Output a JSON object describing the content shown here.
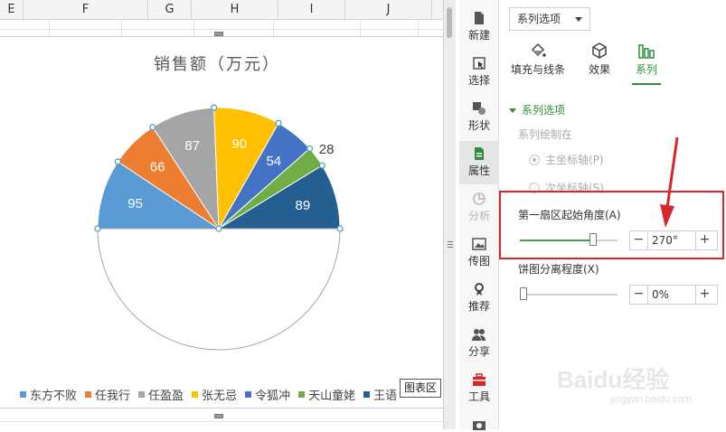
{
  "sheet": {
    "columns": [
      "E",
      "F",
      "G",
      "H",
      "I",
      "J"
    ]
  },
  "chart": {
    "tooltip": "图表区"
  },
  "chart_data": {
    "type": "pie",
    "title": "销售额（万元）",
    "first_slice_angle_deg": 270,
    "categories": [
      "东方不败",
      "任我行",
      "任盈盈",
      "张无忌",
      "令狐冲",
      "天山童姥",
      "王语嫣"
    ],
    "legend_labels": [
      "东方不败",
      "任我行",
      "任盈盈",
      "张无忌",
      "令狐冲",
      "天山童姥",
      "王语"
    ],
    "values": [
      95,
      66,
      87,
      90,
      54,
      28,
      89
    ],
    "colors": [
      "#5b9bd5",
      "#ed7d31",
      "#a5a5a5",
      "#ffc000",
      "#4472c4",
      "#70ad47",
      "#255e91"
    ],
    "hidden_slice": {
      "value": 509,
      "fill": "none",
      "border": "#a6a6a6"
    },
    "label_colors": [
      "#ffffff",
      "#ffffff",
      "#ffffff",
      "#ffffff",
      "#ffffff",
      "#404040",
      "#ffffff"
    ],
    "legend_position": "bottom"
  },
  "rail": {
    "items": [
      {
        "label": "新建",
        "icon": "new-doc-icon"
      },
      {
        "label": "选择",
        "icon": "select-cursor-icon"
      },
      {
        "label": "形状",
        "icon": "shapes-icon"
      },
      {
        "label": "属性",
        "icon": "properties-icon"
      },
      {
        "label": "分析",
        "icon": "analysis-icon"
      },
      {
        "label": "传图",
        "icon": "upload-image-icon"
      },
      {
        "label": "推荐",
        "icon": "recommend-icon"
      },
      {
        "label": "分享",
        "icon": "share-icon"
      },
      {
        "label": "工具",
        "icon": "toolbox-icon"
      }
    ]
  },
  "panel": {
    "dropdown_label": "系列选项",
    "tabs": [
      {
        "label": "填充与线条",
        "icon": "fill-bucket-icon"
      },
      {
        "label": "效果",
        "icon": "effects-cube-icon"
      },
      {
        "label": "系列",
        "icon": "series-bars-icon"
      }
    ],
    "section_title": "系列选项",
    "plot_on_label": "系列绘制在",
    "primary_axis": "主坐标轴(P)",
    "secondary_axis": "次坐标轴(S)",
    "first_slice_label": "第一扇区起始角度(A)",
    "first_slice_value": "270°",
    "first_slice_fraction": 0.75,
    "explosion_label": "饼图分离程度(X)",
    "explosion_value": "0%",
    "explosion_fraction": 0.0,
    "highlight_color": "#d9262b",
    "accent_color": "#2f8d3a"
  },
  "watermark": {
    "text": "Baidu经验",
    "sub": "jingyan.baidu.com"
  }
}
